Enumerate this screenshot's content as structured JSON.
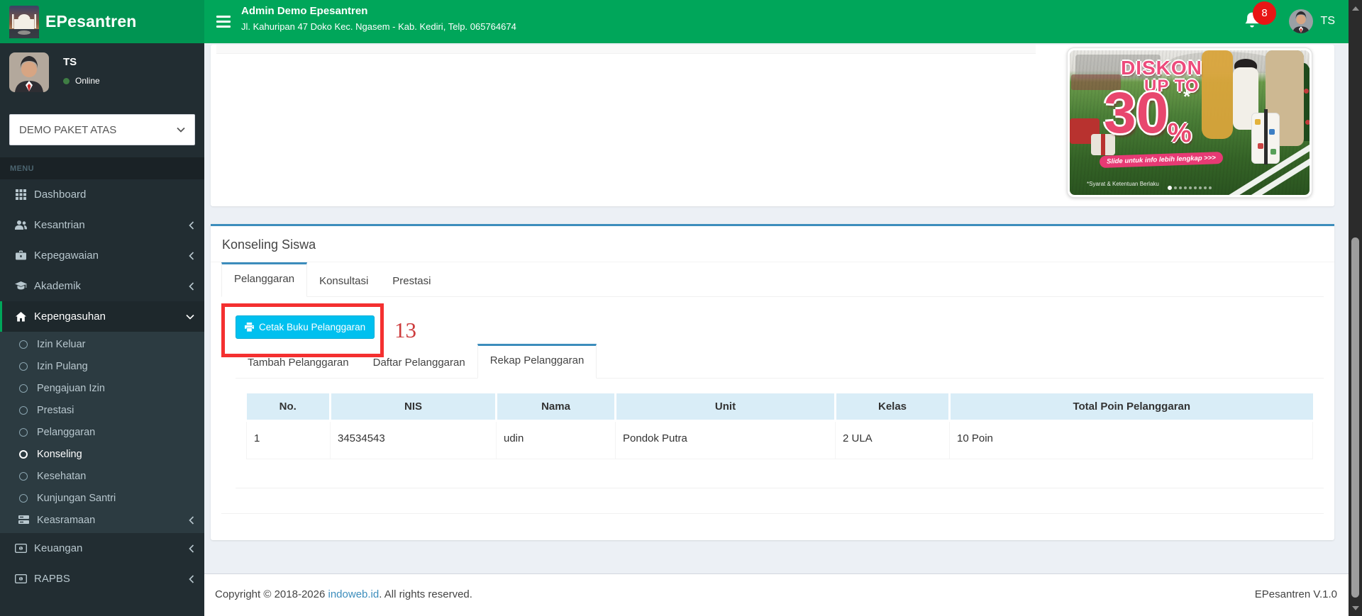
{
  "brand": {
    "name": "EPesantren",
    "logo_icon": "mosque-icon"
  },
  "navbar": {
    "title": "Admin Demo Epesantren",
    "subtitle": "Jl. Kahuripan 47 Doko Kec. Ngasem - Kab. Kediri, Telp. 065764674",
    "notification_count": "8",
    "user_initials": "TS"
  },
  "sidebar": {
    "user": {
      "name": "TS",
      "status": "Online"
    },
    "package_select": {
      "value": "DEMO PAKET ATAS"
    },
    "section_label": "MENU",
    "menu": [
      {
        "label": "Dashboard",
        "icon": "grid-icon"
      },
      {
        "label": "Kesantrian",
        "icon": "users-icon",
        "chevron": "left"
      },
      {
        "label": "Kepegawaian",
        "icon": "briefcase-icon",
        "chevron": "left"
      },
      {
        "label": "Akademik",
        "icon": "graduation-cap-icon",
        "chevron": "left"
      },
      {
        "label": "Kepengasuhan",
        "icon": "home-icon",
        "chevron": "down",
        "active": true
      }
    ],
    "submenu": [
      {
        "label": "Izin Keluar",
        "icon": "circle-icon"
      },
      {
        "label": "Izin Pulang",
        "icon": "circle-icon"
      },
      {
        "label": "Pengajuan Izin",
        "icon": "circle-icon"
      },
      {
        "label": "Prestasi",
        "icon": "circle-icon"
      },
      {
        "label": "Pelanggaran",
        "icon": "circle-icon"
      },
      {
        "label": "Konseling",
        "icon": "circle-icon",
        "active": true
      },
      {
        "label": "Kesehatan",
        "icon": "circle-icon"
      },
      {
        "label": "Kunjungan Santri",
        "icon": "circle-icon"
      },
      {
        "label": "Keasramaan",
        "icon": "server-icon",
        "chevron": "left"
      }
    ],
    "menu_bottom": [
      {
        "label": "Keuangan",
        "icon": "money-icon",
        "chevron": "left"
      },
      {
        "label": "RAPBS",
        "icon": "money-icon",
        "chevron": "left"
      }
    ]
  },
  "ad": {
    "line1": "DISKON",
    "line2": "UP TO",
    "discount": "30",
    "percent": "%",
    "asterisk": "*",
    "slide_text": "Slide untuk info lebih lengkap >>>",
    "terms": "*Syarat & Ketentuan Berlaku",
    "dots_count": 9,
    "active_dot": 1
  },
  "panel": {
    "title": "Konseling Siswa",
    "tabs": [
      {
        "label": "Pelanggaran",
        "active": true
      },
      {
        "label": "Konsultasi",
        "active": false
      },
      {
        "label": "Prestasi",
        "active": false
      }
    ],
    "print_button": {
      "label": "Cetak Buku Pelanggaran",
      "icon": "printer-icon"
    },
    "subtabs": [
      {
        "label": "Tambah Pelanggaran",
        "active": false
      },
      {
        "label": "Daftar Pelanggaran",
        "active": false
      },
      {
        "label": "Rekap Pelanggaran",
        "active": true
      }
    ],
    "table": {
      "headers": [
        "No.",
        "NIS",
        "Nama",
        "Unit",
        "Kelas",
        "Total Poin Pelanggaran"
      ],
      "rows": [
        [
          "1",
          "34534543",
          "udin",
          "Pondok Putra",
          "2 ULA",
          "10 Poin"
        ]
      ]
    }
  },
  "annotation": {
    "step_number": "13"
  },
  "footer": {
    "copyright_prefix": "Copyright © 2018-2026 ",
    "link": "indoweb.id",
    "copyright_suffix": ". All rights reserved.",
    "version": "EPesantren V.1.0"
  },
  "colors": {
    "navbar_green": "#00a65a",
    "logo_green": "#009452",
    "sidebar_dark": "#222d32",
    "submenu_dark": "#2c3b41",
    "panel_accent_blue": "#3c8dbc",
    "info_button_cyan": "#00c0ef",
    "table_header_blue": "#d9edf7",
    "annotation_red": "#f43030",
    "badge_red": "#e81515",
    "link_blue": "#3c8dbc"
  }
}
